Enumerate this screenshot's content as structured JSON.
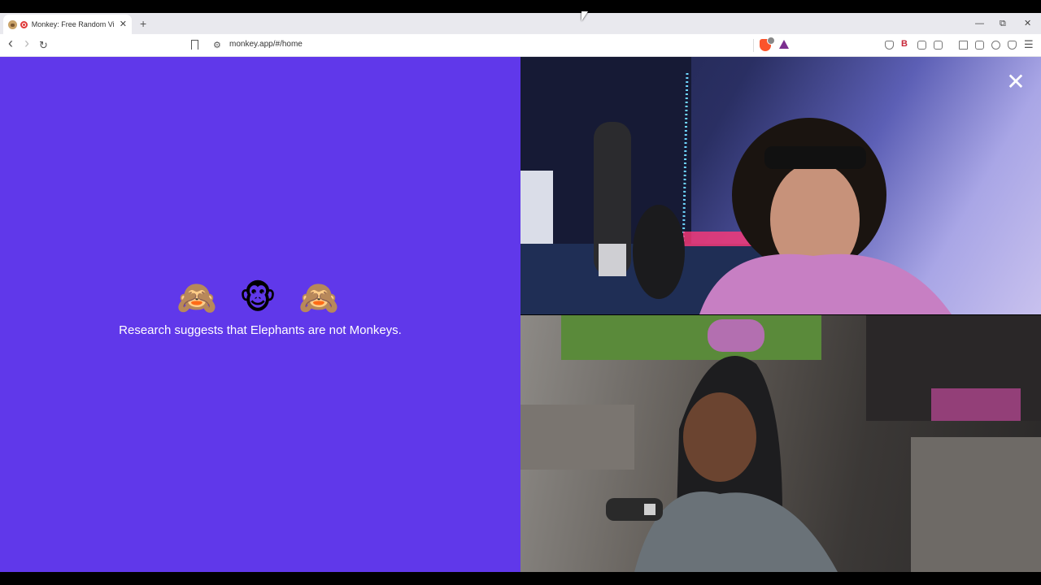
{
  "browser": {
    "tab": {
      "title": "Monkey: Free Random Video Chat",
      "close_glyph": "✕",
      "favicon": "monkey-favicon-icon",
      "recording_indicator": "recording-icon"
    },
    "new_tab_glyph": "+",
    "window_controls": {
      "minimize": "—",
      "maximize": "⧉",
      "close": "✕"
    },
    "nav": {
      "back": "‹",
      "forward": "›",
      "reload": "↻"
    },
    "address": {
      "url": "monkey.app/#/home",
      "site_settings_glyph": "⚙"
    },
    "extensions": [
      "shield-icon",
      "b-extension-icon",
      "puzzle-icon",
      "reader-icon",
      "sidebar-icon",
      "wallet-icon",
      "leo-ai-icon",
      "vpn-icon"
    ],
    "b_label": "B",
    "menu_glyph": "☰"
  },
  "app": {
    "background_color": "#6038ea",
    "emojis": [
      "🙈",
      "🐵",
      "🙈"
    ],
    "fact_text": "Research suggests that Elephants are not Monkeys.",
    "close_glyph": "✕"
  },
  "videos": [
    {
      "name": "remote-video-feed",
      "description_icon": "webcam-feed"
    },
    {
      "name": "self-video-feed",
      "description_icon": "webcam-feed"
    }
  ]
}
